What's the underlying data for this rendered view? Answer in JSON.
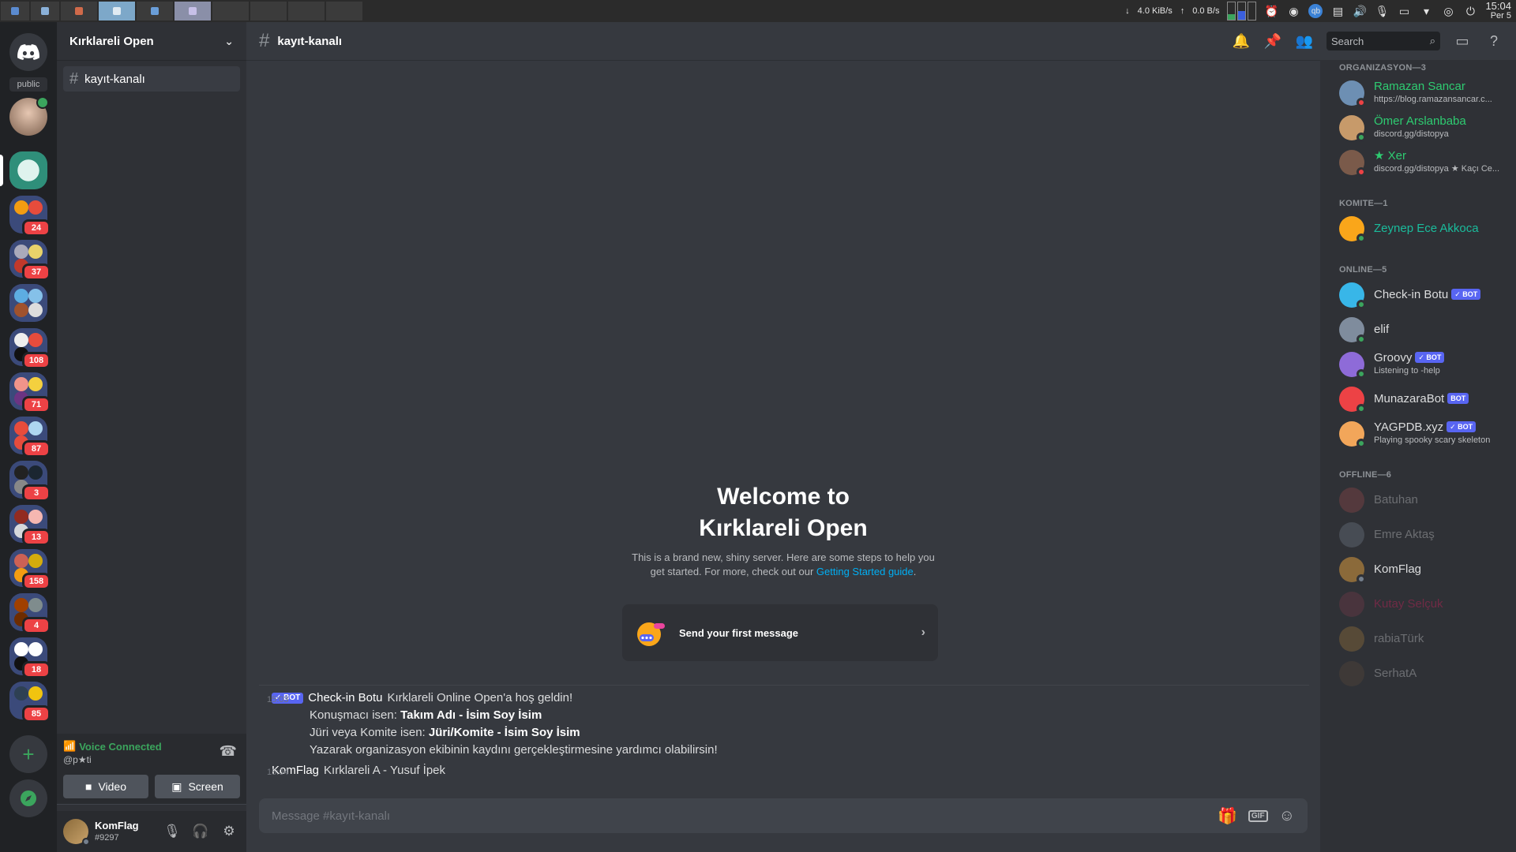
{
  "taskbar": {
    "net_down": "4.0 KiB/s",
    "net_up": "0.0 B/s",
    "clock_time": "15:04",
    "clock_day": "Per 5"
  },
  "rail": {
    "public_label": "public",
    "servers": [
      {
        "badge": "24"
      },
      {
        "badge": "37"
      },
      {
        "badge": ""
      },
      {
        "badge": "108"
      },
      {
        "badge": "71"
      },
      {
        "badge": "87"
      },
      {
        "badge": "3"
      },
      {
        "badge": "13"
      },
      {
        "badge": "158"
      },
      {
        "badge": "4"
      },
      {
        "badge": "18"
      },
      {
        "badge": "85"
      }
    ]
  },
  "sidebar": {
    "server_name": "Kırklareli Open",
    "channel": "kayıt-kanalı",
    "voice_status": "Voice Connected",
    "voice_channel": "@p★ti",
    "video_label": "Video",
    "screen_label": "Screen",
    "username": "KomFlag",
    "discriminator": "#9297"
  },
  "header": {
    "channel": "kayıt-kanalı",
    "search_placeholder": "Search"
  },
  "welcome": {
    "title_line1": "Welcome to",
    "title_line2": "Kırklareli Open",
    "text_line1": "This is a brand new, shiny server. Here are some steps to help you",
    "text_line2": "get started. For more, check out our ",
    "link": "Getting Started guide",
    "period": ".",
    "first_message": "Send your first message"
  },
  "messages": [
    {
      "time": "15:03",
      "bot_tag": "✓ BOT",
      "author": "Check-in Botu",
      "text": "Kırklareli Online Open'a hoş geldin!",
      "lines": [
        {
          "prefix": "Konuşmacı isen: ",
          "bold": "Takım Adı - İsim Soy İsim"
        },
        {
          "prefix": "Jüri veya Komite isen: ",
          "bold": "Jüri/Komite -  İsim Soy İsim"
        },
        {
          "prefix": "Yazarak organizasyon ekibinin kaydını gerçekleştirmesine yardımcı olabilirsin!",
          "bold": ""
        }
      ]
    },
    {
      "time": "15:04",
      "author": "KomFlag",
      "text": "Kırklareli A - Yusuf İpek"
    }
  ],
  "composer": {
    "placeholder": "Message #kayıt-kanalı",
    "gif_label": "GIF"
  },
  "members": {
    "groups": [
      {
        "title": "ORGANIZASYON—3",
        "items": [
          {
            "name": "Ramazan Sancar",
            "status": "https://blog.ramazansancar.c...",
            "color": "#2ecc71",
            "dot": "#ed4245"
          },
          {
            "name": "Ömer Arslanbaba",
            "status": "discord.gg/distopya",
            "color": "#2ecc71",
            "dot": "#3ba55d"
          },
          {
            "name": "★ Xer",
            "status": "discord.gg/distopya ★ Kaçı Ce...",
            "color": "#2ecc71",
            "dot": "#ed4245"
          }
        ]
      },
      {
        "title": "KOMITE—1",
        "items": [
          {
            "name": "Zeynep Ece Akkoca",
            "status": "",
            "color": "#1abc9c",
            "dot": "#3ba55d"
          }
        ]
      },
      {
        "title": "ONLINE—5",
        "items": [
          {
            "name": "Check-in Botu",
            "bot": "✓ BOT",
            "status": "",
            "color": "#dcddde",
            "dot": "#3ba55d"
          },
          {
            "name": "elif",
            "status": "",
            "color": "#dcddde",
            "dot": "#3ba55d"
          },
          {
            "name": "Groovy",
            "bot": "✓ BOT",
            "status": "Listening to -help",
            "color": "#dcddde",
            "dot": "#3ba55d"
          },
          {
            "name": "MunazaraBot",
            "bot": "BOT",
            "status": "",
            "color": "#dcddde",
            "dot": "#3ba55d"
          },
          {
            "name": "YAGPDB.xyz",
            "bot": "✓ BOT",
            "status": "Playing spooky scary skeleton",
            "color": "#dcddde",
            "dot": "#3ba55d"
          }
        ]
      },
      {
        "title": "OFFLINE—6",
        "items": [
          {
            "name": "Batuhan",
            "status": "",
            "color": "#dcddde",
            "offline": true
          },
          {
            "name": "Emre Aktaş",
            "status": "",
            "color": "#dcddde",
            "offline": true
          },
          {
            "name": "KomFlag",
            "status": "",
            "color": "#dcddde",
            "dot": "#747f8d"
          },
          {
            "name": "Kutay Selçuk",
            "status": "",
            "color": "#e91e63",
            "offline": true
          },
          {
            "name": "rabiaTürk",
            "status": "",
            "color": "#dcddde",
            "offline": true
          },
          {
            "name": "SerhatA",
            "status": "",
            "color": "#dcddde",
            "offline": true
          }
        ]
      }
    ]
  }
}
